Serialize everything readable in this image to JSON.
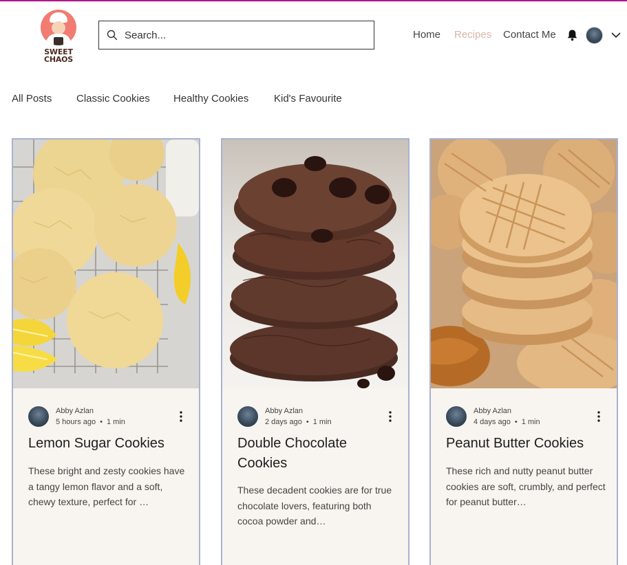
{
  "header": {
    "logo_text_line1": "SWEET",
    "logo_text_line2": "CHAOS",
    "search_placeholder": "Search...",
    "nav": {
      "home": "Home",
      "recipes": "Recipes",
      "contact": "Contact Me"
    },
    "icons": {
      "search": "search-icon",
      "bell": "bell-icon",
      "chevron": "chevron-down-icon"
    },
    "colors": {
      "accent_line": "#b0168c",
      "active_nav": "#d9b5a7"
    }
  },
  "categories": [
    "All Posts",
    "Classic Cookies",
    "Healthy Cookies",
    "Kid's Favourite"
  ],
  "posts": [
    {
      "author": "Abby Azlan",
      "time": "5 hours ago",
      "read": "1 min",
      "title": "Lemon Sugar Cookies",
      "excerpt": "These bright and zesty cookies have a tangy lemon flavor and a soft, chewy texture, perfect for …"
    },
    {
      "author": "Abby Azlan",
      "time": "2 days ago",
      "read": "1 min",
      "title": "Double Chocolate Cookies",
      "excerpt": "These decadent cookies are for true chocolate lovers, featuring both cocoa powder and…"
    },
    {
      "author": "Abby Azlan",
      "time": "4 days ago",
      "read": "1 min",
      "title": "Peanut Butter Cookies",
      "excerpt": "These rich and nutty peanut butter cookies are soft, crumbly, and perfect for peanut butter…"
    }
  ]
}
